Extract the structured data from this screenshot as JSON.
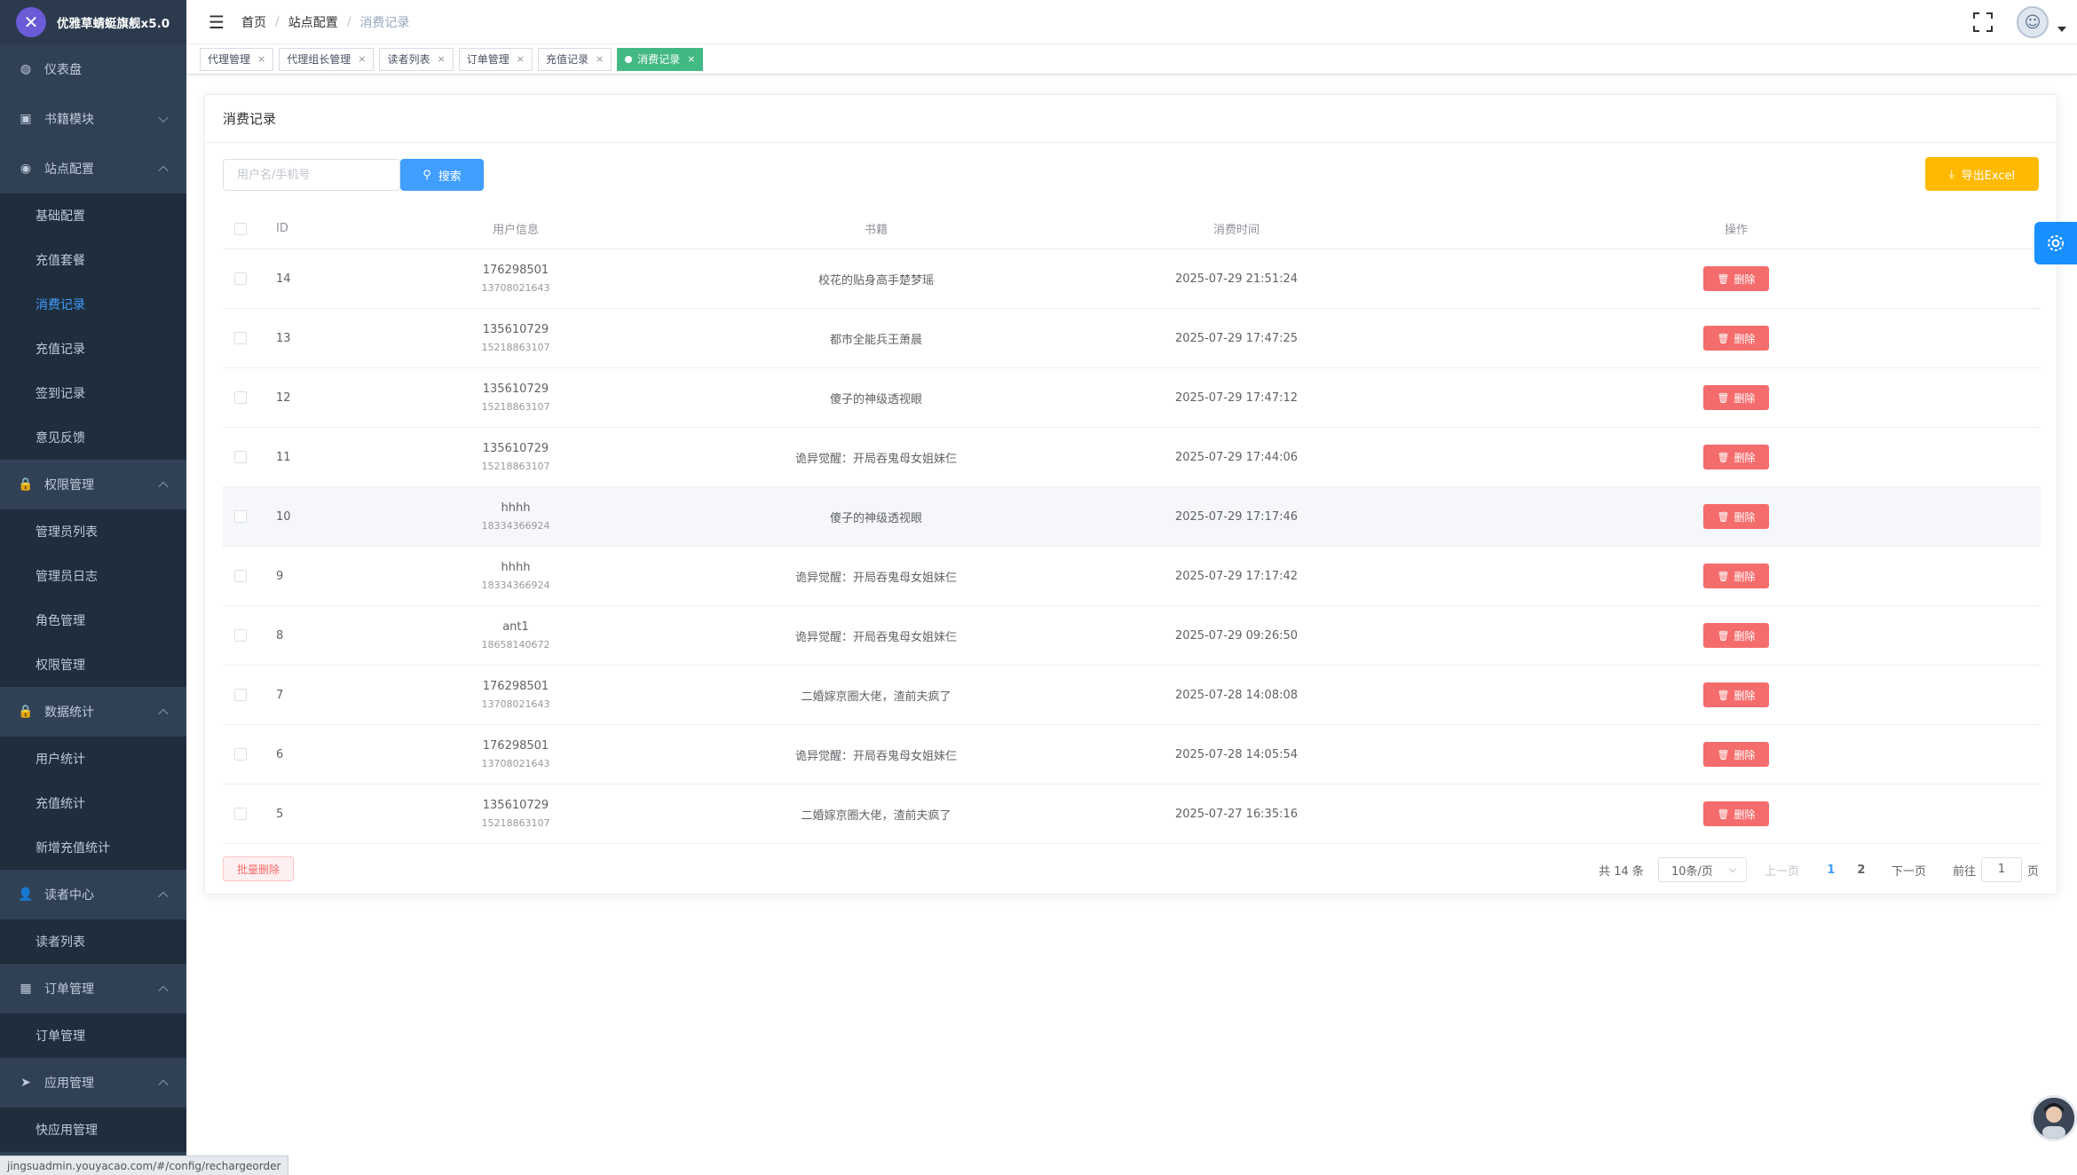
{
  "app": {
    "title": "优雅草蜻蜓旗舰x5.0"
  },
  "sidebar": {
    "items": [
      {
        "label": "仪表盘",
        "icon": "dashboard-icon",
        "glyph": "◍",
        "expandable": false,
        "open": false,
        "children": []
      },
      {
        "label": "书籍模块",
        "icon": "book-icon",
        "glyph": "▣",
        "expandable": true,
        "open": false,
        "children": []
      },
      {
        "label": "站点配置",
        "icon": "site-config-icon",
        "glyph": "◉",
        "expandable": true,
        "open": true,
        "children": [
          {
            "label": "基础配置",
            "active": false
          },
          {
            "label": "充值套餐",
            "active": false
          },
          {
            "label": "消费记录",
            "active": true
          },
          {
            "label": "充值记录",
            "active": false
          },
          {
            "label": "签到记录",
            "active": false
          },
          {
            "label": "意见反馈",
            "active": false
          }
        ]
      },
      {
        "label": "权限管理",
        "icon": "lock-icon",
        "glyph": "🔒",
        "expandable": true,
        "open": true,
        "children": [
          {
            "label": "管理员列表",
            "active": false
          },
          {
            "label": "管理员日志",
            "active": false
          },
          {
            "label": "角色管理",
            "active": false
          },
          {
            "label": "权限管理",
            "active": false
          }
        ]
      },
      {
        "label": "数据统计",
        "icon": "lock-icon",
        "glyph": "🔒",
        "expandable": true,
        "open": true,
        "children": [
          {
            "label": "用户统计",
            "active": false
          },
          {
            "label": "充值统计",
            "active": false
          },
          {
            "label": "新增充值统计",
            "active": false
          }
        ]
      },
      {
        "label": "读者中心",
        "icon": "user-icon",
        "glyph": "👤",
        "expandable": true,
        "open": true,
        "children": [
          {
            "label": "读者列表",
            "active": false
          }
        ]
      },
      {
        "label": "订单管理",
        "icon": "grid-icon",
        "glyph": "▦",
        "expandable": true,
        "open": true,
        "children": [
          {
            "label": "订单管理",
            "active": false
          }
        ]
      },
      {
        "label": "应用管理",
        "icon": "send-icon",
        "glyph": "➤",
        "expandable": true,
        "open": true,
        "children": [
          {
            "label": "快应用管理",
            "active": false
          }
        ]
      }
    ]
  },
  "status_url": "jingsuadmin.youyacao.com/#/config/rechargeorder",
  "breadcrumb": [
    "首页",
    "站点配置",
    "消费记录"
  ],
  "tags": [
    {
      "label": "代理管理",
      "active": false
    },
    {
      "label": "代理组长管理",
      "active": false
    },
    {
      "label": "读者列表",
      "active": false
    },
    {
      "label": "订单管理",
      "active": false
    },
    {
      "label": "充值记录",
      "active": false
    },
    {
      "label": "消费记录",
      "active": true
    }
  ],
  "card": {
    "title": "消费记录"
  },
  "search": {
    "placeholder": "用户名/手机号",
    "value": "",
    "button": "搜索"
  },
  "export_button": "导出Excel",
  "table": {
    "columns": [
      "ID",
      "用户信息",
      "书籍",
      "消费时间",
      "操作"
    ],
    "delete_label": "删除",
    "rows": [
      {
        "id": "14",
        "user": "176298501",
        "phone": "13708021643",
        "book": "校花的贴身高手楚梦瑶",
        "time": "2025-07-29 21:51:24"
      },
      {
        "id": "13",
        "user": "135610729",
        "phone": "15218863107",
        "book": "都市全能兵王萧晨",
        "time": "2025-07-29 17:47:25"
      },
      {
        "id": "12",
        "user": "135610729",
        "phone": "15218863107",
        "book": "傻子的神级透视眼",
        "time": "2025-07-29 17:47:12"
      },
      {
        "id": "11",
        "user": "135610729",
        "phone": "15218863107",
        "book": "诡异觉醒：开局吞鬼母女姐妹仨",
        "time": "2025-07-29 17:44:06"
      },
      {
        "id": "10",
        "user": "hhhh",
        "phone": "18334366924",
        "book": "傻子的神级透视眼",
        "time": "2025-07-29 17:17:46",
        "highlight": true
      },
      {
        "id": "9",
        "user": "hhhh",
        "phone": "18334366924",
        "book": "诡异觉醒：开局吞鬼母女姐妹仨",
        "time": "2025-07-29 17:17:42"
      },
      {
        "id": "8",
        "user": "ant1",
        "phone": "18658140672",
        "book": "诡异觉醒：开局吞鬼母女姐妹仨",
        "time": "2025-07-29 09:26:50"
      },
      {
        "id": "7",
        "user": "176298501",
        "phone": "13708021643",
        "book": "二婚嫁京圈大佬，渣前夫疯了",
        "time": "2025-07-28 14:08:08"
      },
      {
        "id": "6",
        "user": "176298501",
        "phone": "13708021643",
        "book": "诡异觉醒：开局吞鬼母女姐妹仨",
        "time": "2025-07-28 14:05:54"
      },
      {
        "id": "5",
        "user": "135610729",
        "phone": "15218863107",
        "book": "二婚嫁京圈大佬，渣前夫疯了",
        "time": "2025-07-27 16:35:16"
      }
    ]
  },
  "batch_delete": "批量删除",
  "pagination": {
    "total": "共 14 条",
    "page_size": "10条/页",
    "prev": "上一页",
    "pages": [
      "1",
      "2"
    ],
    "current": "1",
    "next": "下一页",
    "goto_prefix": "前往",
    "goto_value": "1",
    "goto_suffix": "页"
  },
  "colors": {
    "sidebar_bg": "#304156",
    "submenu_bg": "#1f2d3d",
    "primary": "#409eff",
    "danger": "#f56c6c",
    "warning": "#ffba00",
    "tag_active": "#42b983"
  }
}
